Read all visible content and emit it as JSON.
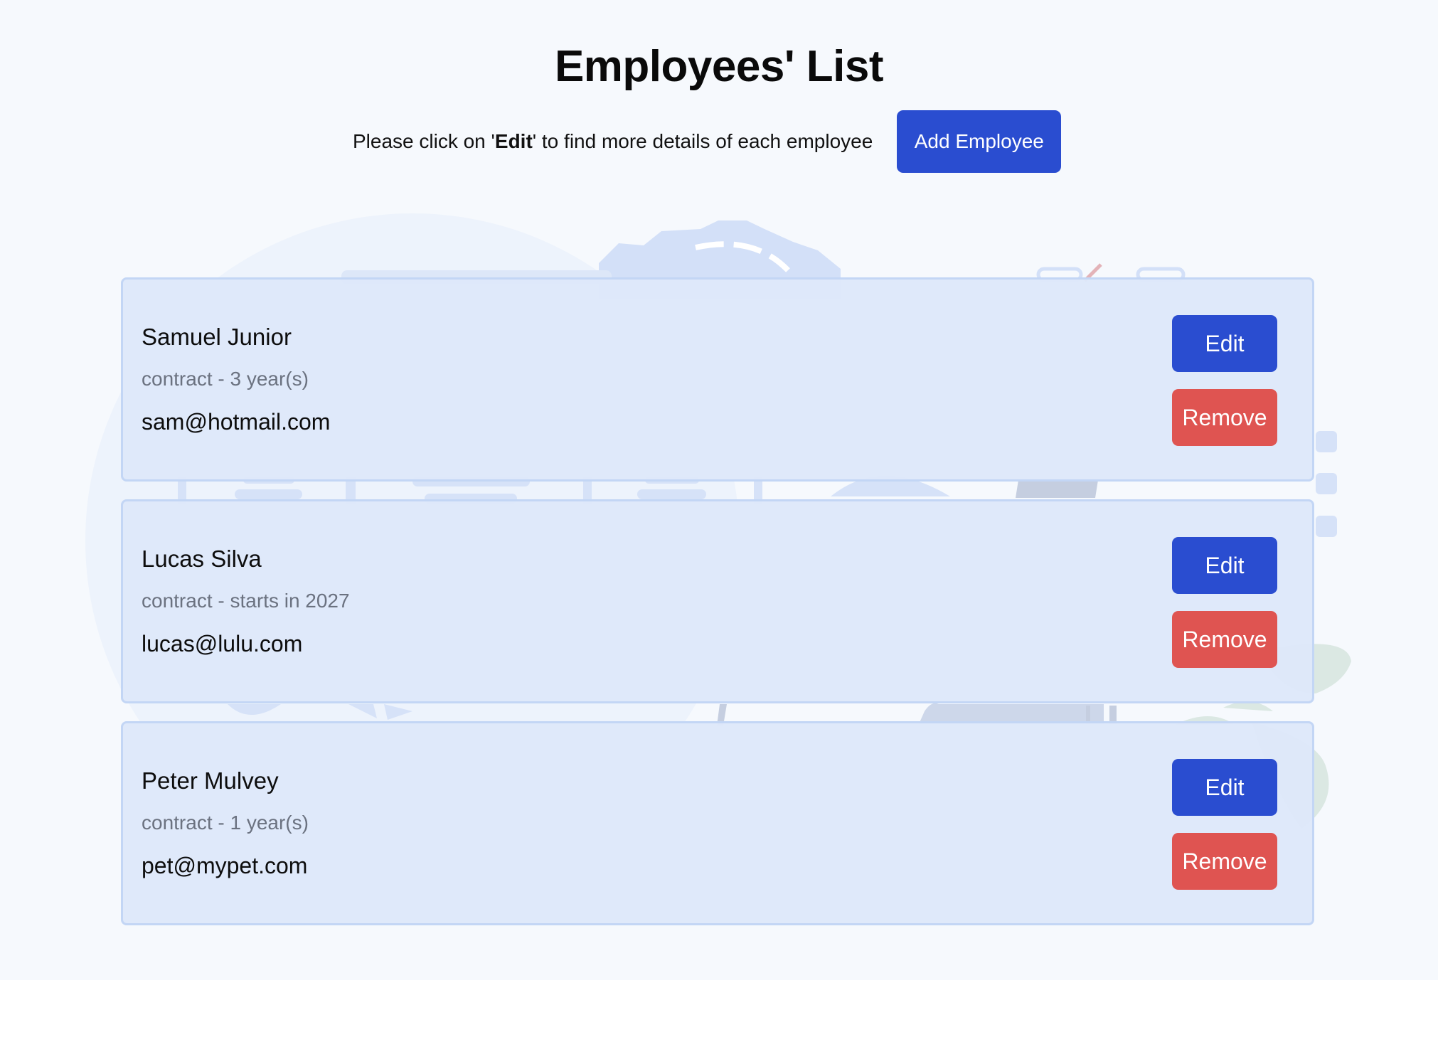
{
  "page": {
    "title": "Employees' List",
    "instructions_prefix": "Please click on '",
    "instructions_emphasis": "Edit",
    "instructions_suffix": "' to find more details of each employee",
    "add_button_label": "Add Employee"
  },
  "employees": [
    {
      "name": "Samuel Junior",
      "contract": "contract - 3 year(s)",
      "email": "sam@hotmail.com",
      "edit_label": "Edit",
      "remove_label": "Remove"
    },
    {
      "name": "Lucas Silva",
      "contract": "contract - starts in 2027",
      "email": "lucas@lulu.com",
      "edit_label": "Edit",
      "remove_label": "Remove"
    },
    {
      "name": "Peter Mulvey",
      "contract": "contract - 1 year(s)",
      "email": "pet@mypet.com",
      "edit_label": "Edit",
      "remove_label": "Remove"
    }
  ],
  "colors": {
    "page_background": "#f6f9fd",
    "primary_button": "#2a4dd0",
    "danger_button": "#df5451",
    "card_background": "#dee8fa",
    "card_border": "#c3d6f5",
    "muted_text": "#6b7280"
  },
  "icons": {
    "background_illustration": "office-team-illustration"
  }
}
